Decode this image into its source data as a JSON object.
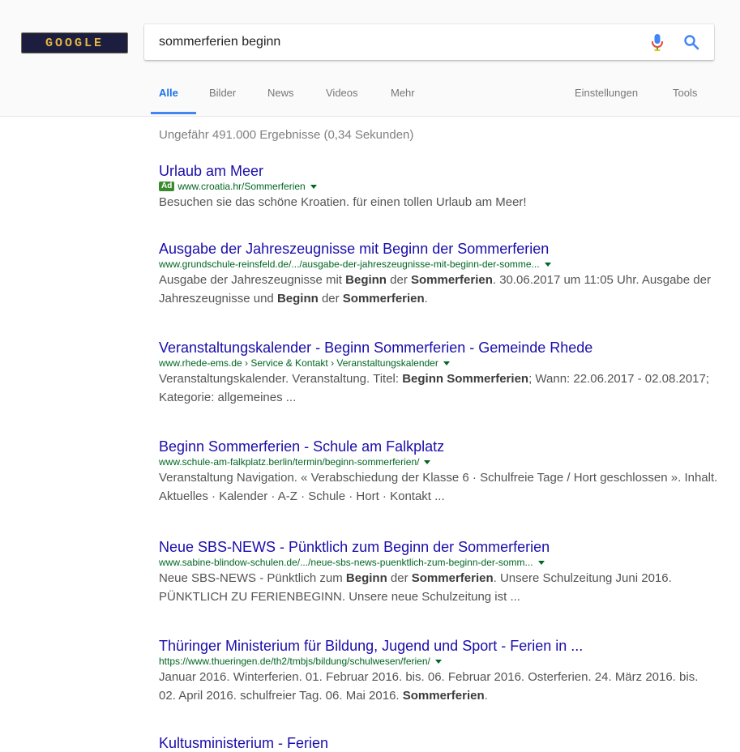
{
  "search": {
    "logo_text": "GOOGLE",
    "query": "sommerferien beginn"
  },
  "tabs": {
    "alle": "Alle",
    "bilder": "Bilder",
    "news": "News",
    "videos": "Videos",
    "mehr": "Mehr",
    "einstellungen": "Einstellungen",
    "tools": "Tools"
  },
  "stats": "Ungefähr 491.000 Ergebnisse (0,34 Sekunden)",
  "results": [
    {
      "title": "Urlaub am Meer",
      "ad": "Ad",
      "url": "www.croatia.hr/Sommerferien",
      "snippet": [
        {
          "t": "Besuchen sie das schöne Kroatien. für einen tollen Urlaub am Meer!",
          "b": false
        }
      ]
    },
    {
      "title": "Ausgabe der Jahreszeugnisse mit Beginn der Sommerferien",
      "url": "www.grundschule-reinsfeld.de/.../ausgabe-der-jahreszeugnisse-mit-beginn-der-somme...",
      "snippet": [
        {
          "t": "Ausgabe der Jahreszeugnisse mit ",
          "b": false
        },
        {
          "t": "Beginn",
          "b": true
        },
        {
          "t": " der ",
          "b": false
        },
        {
          "t": "Sommerferien",
          "b": true
        },
        {
          "t": ". 30.06.2017 um 11:05 Uhr. Ausgabe der Jahreszeugnisse und ",
          "b": false
        },
        {
          "t": "Beginn",
          "b": true
        },
        {
          "t": " der ",
          "b": false
        },
        {
          "t": "Sommerferien",
          "b": true
        },
        {
          "t": ".",
          "b": false
        }
      ]
    },
    {
      "title": "Veranstaltungskalender - Beginn Sommerferien - Gemeinde Rhede",
      "url": "www.rhede-ems.de › Service & Kontakt › Veranstaltungskalender",
      "snippet": [
        {
          "t": "Veranstaltungskalender. Veranstaltung. Titel: ",
          "b": false
        },
        {
          "t": "Beginn Sommerferien",
          "b": true
        },
        {
          "t": "; Wann: 22.06.2017 - 02.08.2017; Kategorie: allgemeines ...",
          "b": false
        }
      ]
    },
    {
      "title": "Beginn Sommerferien - Schule am Falkplatz",
      "url": "www.schule-am-falkplatz.berlin/termin/beginn-sommerferien/",
      "snippet": [
        {
          "t": "Veranstaltung Navigation. « Verabschiedung der Klasse 6 · Schulfreie Tage / Hort geschlossen ». Inhalt. Aktuelles · Kalender · A-Z · Schule · Hort · Kontakt ...",
          "b": false
        }
      ]
    },
    {
      "title": "Neue SBS-NEWS - Pünktlich zum Beginn der Sommerferien",
      "url": "www.sabine-blindow-schulen.de/.../neue-sbs-news-puenktlich-zum-beginn-der-somm...",
      "snippet": [
        {
          "t": "Neue SBS-NEWS - Pünktlich zum ",
          "b": false
        },
        {
          "t": "Beginn",
          "b": true
        },
        {
          "t": " der ",
          "b": false
        },
        {
          "t": "Sommerferien",
          "b": true
        },
        {
          "t": ". Unsere Schulzeitung Juni 2016. PÜNKTLICH ZU FERIENBEGINN. Unsere neue Schulzeitung ist ...",
          "b": false
        }
      ]
    },
    {
      "title": "Thüringer Ministerium für Bildung, Jugend und Sport - Ferien in ...",
      "url": "https://www.thueringen.de/th2/tmbjs/bildung/schulwesen/ferien/",
      "snippet": [
        {
          "t": "Januar 2016. Winterferien. 01. Februar 2016. bis. 06. Februar 2016. Osterferien. 24. März 2016. bis. 02. April 2016. schulfreier Tag. 06. Mai 2016. ",
          "b": false
        },
        {
          "t": "Sommerferien",
          "b": true
        },
        {
          "t": ".",
          "b": false
        }
      ]
    },
    {
      "title": "Kultusministerium - Ferien"
    }
  ]
}
